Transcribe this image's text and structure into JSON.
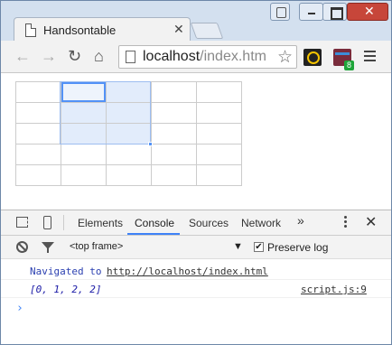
{
  "browser": {
    "tab_title": "Handsontable",
    "tab_close": "✕",
    "url_host": "localhost",
    "url_path": "/index.htm",
    "ext_badge": "8",
    "window_close": "✕"
  },
  "nav": {
    "back": "←",
    "forward": "→",
    "reload": "↻",
    "home": "⌂",
    "star": "☆"
  },
  "icons": {
    "page": "page-icon",
    "inspect": "inspect-icon",
    "device": "device-toolbar-icon",
    "clear": "clear-console-icon",
    "filter": "filter-icon"
  },
  "grid": {
    "rows": 5,
    "cols": 5,
    "selection_color": "#e2ecfb",
    "accent_color": "#5292f7"
  },
  "devtools": {
    "tabs": [
      "Elements",
      "Console",
      "Sources",
      "Network"
    ],
    "active_tab": "Console",
    "more": "»",
    "close": "✕",
    "frame_select": "<top frame>",
    "frame_arrow": "▼",
    "preserve_log_label": "Preserve log",
    "preserve_log_checked": true,
    "checkmark": "✔"
  },
  "console": {
    "navigated_text": "Navigated to",
    "navigated_url": "http://localhost/index.html",
    "log_value": "[0, 1, 2, 2]",
    "log_source": "script.js:9",
    "prompt": "›"
  }
}
